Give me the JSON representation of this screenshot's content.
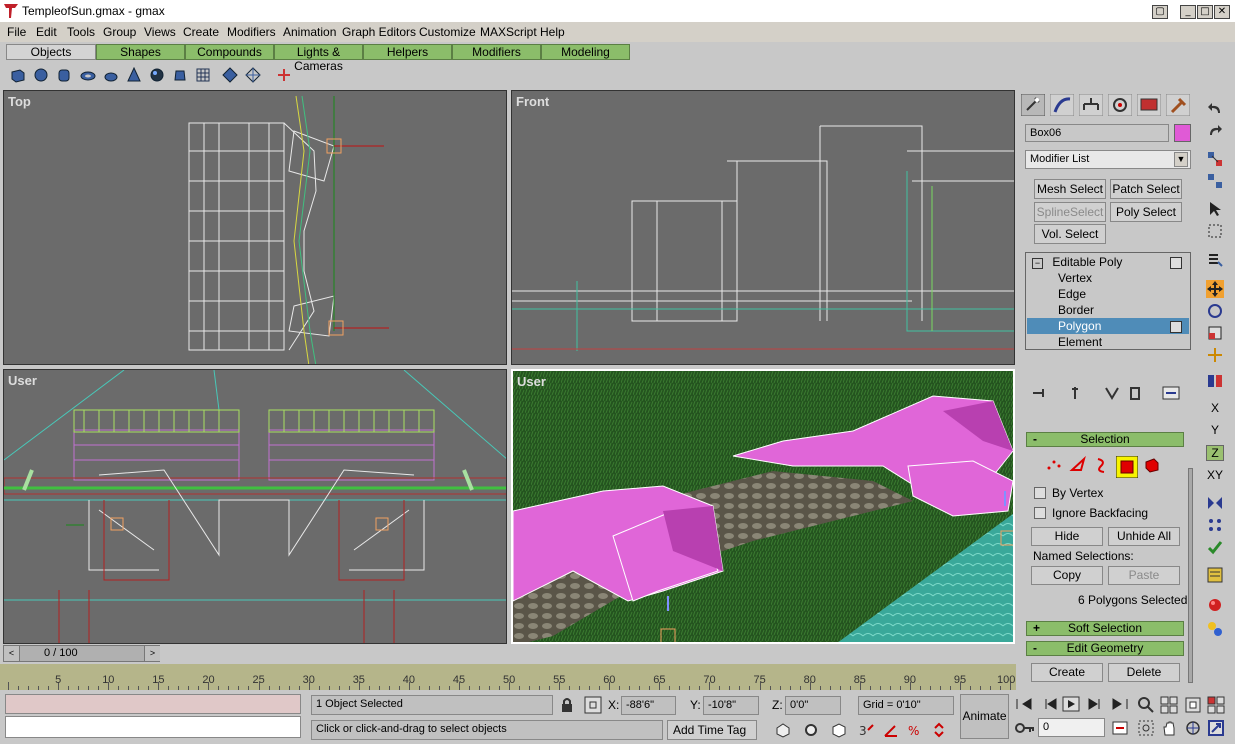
{
  "window": {
    "title": "TempleofSun.gmax - gmax",
    "app": "gmax"
  },
  "menu": [
    "File",
    "Edit",
    "Tools",
    "Group",
    "Views",
    "Create",
    "Modifiers",
    "Animation",
    "Graph Editors",
    "Customize",
    "MAXScript",
    "Help"
  ],
  "tabs": [
    "Objects",
    "Shapes",
    "Compounds",
    "Lights & Cameras",
    "Helpers",
    "Modifiers",
    "Modeling"
  ],
  "viewports": {
    "top": "Top",
    "front": "Front",
    "user1": "User",
    "user2": "User"
  },
  "panel": {
    "object_name": "Box06",
    "object_color": "#e05ad6",
    "modifier_list": "Modifier List",
    "buttons": {
      "mesh_select": "Mesh Select",
      "patch_select": "Patch Select",
      "spline_select": "SplineSelect",
      "poly_select": "Poly Select",
      "vol_select": "Vol. Select"
    },
    "stack": [
      "Editable Poly",
      "Vertex",
      "Edge",
      "Border",
      "Polygon",
      "Element"
    ],
    "selection": {
      "title": "Selection",
      "by_vertex": "By Vertex",
      "ignore_backfacing": "Ignore Backfacing",
      "hide": "Hide",
      "unhide_all": "Unhide All",
      "named_selections": "Named Selections:",
      "copy": "Copy",
      "paste": "Paste",
      "status": "6 Polygons Selected"
    },
    "soft_selection": "Soft Selection",
    "edit_geometry": "Edit Geometry",
    "create": "Create",
    "delete": "Delete"
  },
  "timeline": {
    "frame": "0 / 100",
    "ticks": [
      "5",
      "10",
      "15",
      "20",
      "25",
      "30",
      "35",
      "40",
      "45",
      "50",
      "55",
      "60",
      "65",
      "70",
      "75",
      "80",
      "85",
      "90",
      "95",
      "100"
    ]
  },
  "status": {
    "selected": "1 Object Selected",
    "prompt": "Click or click-and-drag to select objects",
    "x_label": "X:",
    "x": "-88'6\"",
    "y_label": "Y:",
    "y": "-10'8\"",
    "z_label": "Z:",
    "z": "0'0\"",
    "grid": "Grid = 0'10\"",
    "add_time_tag": "Add Time Tag",
    "animate": "Animate",
    "frame_field": "0"
  },
  "axis_letters": [
    "X",
    "Y",
    "Z",
    "XY"
  ]
}
